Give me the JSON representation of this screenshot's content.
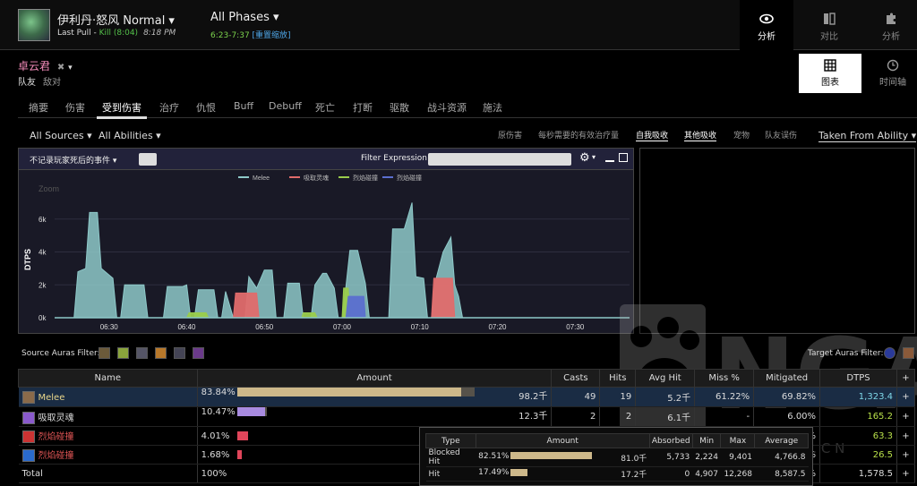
{
  "header": {
    "boss_title": "伊利丹·怒风 Normal ▾",
    "pull_label": "Last Pull - ",
    "pull_result": "Kill (8:04)",
    "pull_time": "8:18 PM",
    "phase_title": "All Phases ▾",
    "phase_range": "6:23-7:37",
    "phase_reset": "[重置缩放]",
    "nav": [
      {
        "label": "分析",
        "icon": "eye-icon"
      },
      {
        "label": "对比",
        "icon": "compare-icon"
      },
      {
        "label": "分析",
        "icon": "puzzle-icon"
      }
    ]
  },
  "player": {
    "name": "卓云君",
    "close": "✖",
    "role_ally": "队友",
    "role_enemy": "敌对"
  },
  "views": [
    {
      "label": "图表",
      "icon": "grid-icon"
    },
    {
      "label": "时间轴",
      "icon": "clock-icon"
    }
  ],
  "tabs": [
    "摘要",
    "伤害",
    "受到伤害",
    "治疗",
    "仇恨",
    "Buff",
    "Debuff",
    "死亡",
    "打断",
    "驱散",
    "战斗资源",
    "施法"
  ],
  "filters": {
    "sources": "All Sources ▾",
    "abilities": "All Abilities ▾",
    "options": [
      "原伤害",
      "每秒需要的有效治疗量",
      "自我吸收",
      "其他吸收",
      "宠物",
      "队友误伤"
    ],
    "taken_from": "Taken From Ability ▾"
  },
  "chart_toolbar": {
    "death_filter": "不记录玩家死后的事件 ▾",
    "filter_label": "Filter Expression:",
    "filter_value": ""
  },
  "chart_data": {
    "type": "area",
    "ylabel": "DTPS",
    "zoom_label": "Zoom",
    "legend": [
      {
        "name": "Melee",
        "color": "#8ec9c9"
      },
      {
        "name": "吸取灵魂",
        "color": "#e06b6b"
      },
      {
        "name": "烈焰碰撞",
        "color": "#9acd4c"
      },
      {
        "name": "烈焰碰撞",
        "color": "#5b6fcf"
      }
    ],
    "x_ticks": [
      "06:30",
      "06:40",
      "06:50",
      "07:00",
      "07:10",
      "07:20",
      "07:30"
    ],
    "y_ticks": [
      "0k",
      "2k",
      "4k",
      "6k"
    ],
    "ylim": [
      0,
      8000
    ],
    "xlim": [
      383,
      457
    ],
    "series": [
      {
        "name": "Melee",
        "color": "#8ec9c9",
        "points": [
          [
            385.5,
            0
          ],
          [
            386,
            2800
          ],
          [
            387,
            3000
          ],
          [
            387.5,
            6400
          ],
          [
            388.5,
            6400
          ],
          [
            389,
            3000
          ],
          [
            390.5,
            2400
          ],
          [
            391,
            0
          ],
          [
            391.5,
            0
          ],
          [
            392,
            2000
          ],
          [
            394.5,
            2000
          ],
          [
            395,
            0
          ],
          [
            397,
            0
          ],
          [
            397.5,
            1900
          ],
          [
            399.5,
            1900
          ],
          [
            400,
            2000
          ],
          [
            400.5,
            0
          ],
          [
            401,
            0
          ],
          [
            401.5,
            1700
          ],
          [
            403.5,
            1700
          ],
          [
            404,
            0
          ],
          [
            404.5,
            0
          ],
          [
            405,
            1600
          ],
          [
            406,
            0
          ],
          [
            407.5,
            0
          ],
          [
            408,
            2500
          ],
          [
            409,
            1800
          ],
          [
            410,
            2900
          ],
          [
            411,
            2900
          ],
          [
            411.5,
            0
          ],
          [
            412.5,
            0
          ],
          [
            413,
            2100
          ],
          [
            414.5,
            2100
          ],
          [
            415,
            0
          ],
          [
            416,
            0
          ],
          [
            416.5,
            2000
          ],
          [
            417.5,
            2700
          ],
          [
            418,
            2700
          ],
          [
            419,
            1800
          ],
          [
            419.5,
            0
          ],
          [
            420,
            0
          ],
          [
            420.5,
            1900
          ],
          [
            421,
            4100
          ],
          [
            422,
            4100
          ],
          [
            423,
            2100
          ],
          [
            423.5,
            0
          ],
          [
            426,
            0
          ],
          [
            426.5,
            5400
          ],
          [
            428,
            5400
          ],
          [
            429,
            7000
          ],
          [
            429.5,
            2500
          ],
          [
            430.5,
            2400
          ],
          [
            431,
            0
          ],
          [
            431.5,
            0
          ],
          [
            432,
            2200
          ],
          [
            433,
            4000
          ],
          [
            434,
            4900
          ],
          [
            434.5,
            2000
          ],
          [
            435,
            1300
          ],
          [
            435.5,
            0
          ],
          [
            456,
            0
          ]
        ]
      },
      {
        "name": "吸取灵魂",
        "color": "#e06b6b",
        "points": [
          [
            406,
            0
          ],
          [
            406.3,
            1500
          ],
          [
            409,
            1500
          ],
          [
            409.3,
            0
          ],
          [
            431.5,
            0
          ],
          [
            431.8,
            2400
          ],
          [
            434.2,
            2400
          ],
          [
            434.5,
            0
          ]
        ]
      },
      {
        "name": "烈焰碰撞",
        "color": "#9acd4c",
        "points": [
          [
            400,
            0
          ],
          [
            400.3,
            300
          ],
          [
            402.5,
            300
          ],
          [
            402.8,
            0
          ],
          [
            414.8,
            0
          ],
          [
            415,
            300
          ],
          [
            416.5,
            300
          ],
          [
            416.8,
            0
          ],
          [
            420,
            0
          ],
          [
            420.2,
            1800
          ],
          [
            420.8,
            1800
          ],
          [
            421,
            0
          ]
        ]
      },
      {
        "name": "烈焰碰撞",
        "color": "#5b6fcf",
        "points": [
          [
            420.5,
            0
          ],
          [
            420.8,
            1300
          ],
          [
            422.8,
            1300
          ],
          [
            423,
            0
          ]
        ]
      }
    ]
  },
  "auras": {
    "source_label": "Source Auras Filter:",
    "source_icons": [
      {
        "name": "aura-icon-1",
        "color": "#6b5a3a"
      },
      {
        "name": "aura-icon-2",
        "color": "#8aa43c"
      },
      {
        "name": "aura-icon-3",
        "color": "#555566"
      },
      {
        "name": "aura-icon-4",
        "color": "#b8782a"
      },
      {
        "name": "aura-icon-5",
        "color": "#444455"
      },
      {
        "name": "aura-icon-6",
        "color": "#6a3a8a"
      }
    ],
    "target_label": "Target Auras Filter:",
    "target_icons": [
      {
        "name": "aura-icon-t1",
        "color": "#2a3a9a"
      },
      {
        "name": "aura-icon-t2",
        "color": "#8a5a3a"
      }
    ]
  },
  "table": {
    "columns": [
      "Name",
      "Amount",
      "Casts",
      "Hits",
      "Avg Hit",
      "Miss %",
      "Mitigated",
      "DTPS",
      "+"
    ],
    "rows": [
      {
        "name": "Melee",
        "name_color": "#e8d68a",
        "icon_color": "#8a6a4a",
        "pct": "83.84%",
        "fill": 0.8384,
        "bar_color": "#cdb88a",
        "amount": "98.2千",
        "casts": "49",
        "hits": "19",
        "avg": "5.2千",
        "miss": "61.22%",
        "mitigated": "69.82%",
        "dtps": "1,323.4",
        "dtps_color": "#7fd7e8",
        "plus": "+"
      },
      {
        "name": "吸取灵魂",
        "name_color": "#ddd",
        "icon_color": "#8a5acc",
        "pct": "10.47%",
        "fill": 0.1047,
        "bar_color": "#a88be0",
        "amount": "12.3千",
        "casts": "2",
        "hits": "2",
        "avg": "6.1千",
        "miss": "-",
        "mitigated": "6.00%",
        "dtps": "165.2",
        "dtps_color": "#b8e04a",
        "plus": "+"
      },
      {
        "name": "烈焰碰撞",
        "name_color": "#e05555",
        "icon_color": "#cc3333",
        "pct": "4.01%",
        "fill": 0.0401,
        "bar_color": "#e0455a",
        "amount": "",
        "casts": "",
        "hits": "",
        "avg": "",
        "miss": "",
        "mitigated": "5.00%",
        "dtps": "63.3",
        "dtps_color": "#b8e04a",
        "plus": "+"
      },
      {
        "name": "烈焰碰撞",
        "name_color": "#e05555",
        "icon_color": "#2a6acc",
        "pct": "1.68%",
        "fill": 0.0168,
        "bar_color": "#e0455a",
        "amount": "",
        "casts": "",
        "hits": "",
        "avg": "",
        "miss": "",
        "mitigated": "5.99%",
        "dtps": "26.5",
        "dtps_color": "#b8e04a",
        "plus": "+"
      }
    ],
    "total": {
      "name": "Total",
      "pct": "100%",
      "mitigated": "5.10%",
      "dtps": "1,578.5",
      "plus": "+"
    }
  },
  "tooltip": {
    "columns": [
      "Type",
      "Amount",
      "Absorbed",
      "Min",
      "Max",
      "Average"
    ],
    "rows": [
      {
        "type": "Blocked Hit",
        "pct": "82.51%",
        "fill": 0.8251,
        "amount": "81.0千",
        "absorbed": "5,733",
        "min": "2,224",
        "max": "9,401",
        "avg": "4,766.8"
      },
      {
        "type": "Hit",
        "pct": "17.49%",
        "fill": 0.1749,
        "amount": "17.2千",
        "absorbed": "0",
        "min": "4,907",
        "max": "12,268",
        "avg": "8,587.5"
      }
    ]
  },
  "watermark": {
    "text": "NGA",
    "sub": "B B S . N G A . C N"
  }
}
